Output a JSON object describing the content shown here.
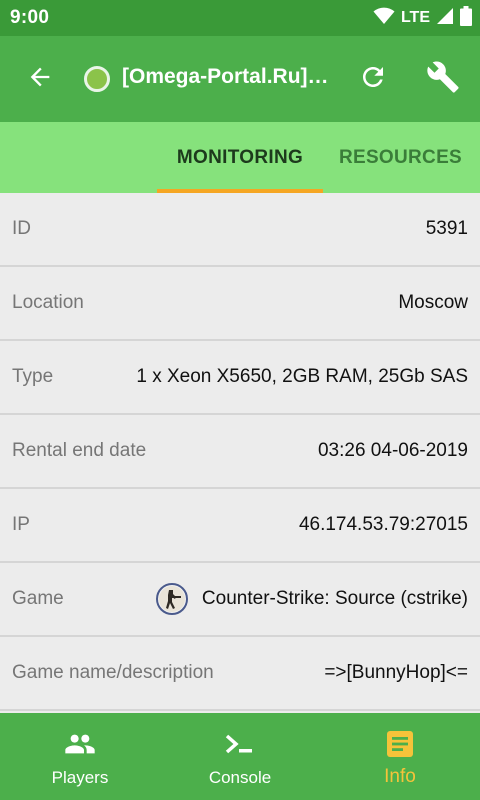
{
  "status_bar": {
    "time": "9:00",
    "network": "LTE"
  },
  "app_bar": {
    "title": "[Omega-Portal.Ru] C..."
  },
  "tabs": [
    {
      "label": "MONITORING",
      "selected": true
    },
    {
      "label": "RESOURCES",
      "selected": false
    }
  ],
  "info_rows": [
    {
      "label": "ID",
      "value": "5391"
    },
    {
      "label": "Location",
      "value": "Moscow"
    },
    {
      "label": "Type",
      "value": "1 x Xeon X5650, 2GB RAM, 25Gb SAS"
    },
    {
      "label": "Rental end date",
      "value": "03:26 04-06-2019"
    },
    {
      "label": "IP",
      "value": "46.174.53.79:27015"
    },
    {
      "label": "Game",
      "value": "Counter-Strike: Source (cstrike)",
      "icon": "counter-strike-game-icon"
    },
    {
      "label": "Game name/description",
      "value": "=>[BunnyHop]<="
    }
  ],
  "bottom_nav": [
    {
      "label": "Players",
      "icon": "players-icon",
      "selected": false
    },
    {
      "label": "Console",
      "icon": "console-icon",
      "selected": false
    },
    {
      "label": "Info",
      "icon": "info-icon",
      "selected": true
    }
  ],
  "colors": {
    "status_bar": "#3a9a38",
    "app_bar": "#4caf4b",
    "tab_bar": "#86e27c",
    "tab_indicator": "#f5a623",
    "selected_nav": "#f5c33a",
    "server_status": "#8bc34a",
    "background": "#ececec"
  }
}
